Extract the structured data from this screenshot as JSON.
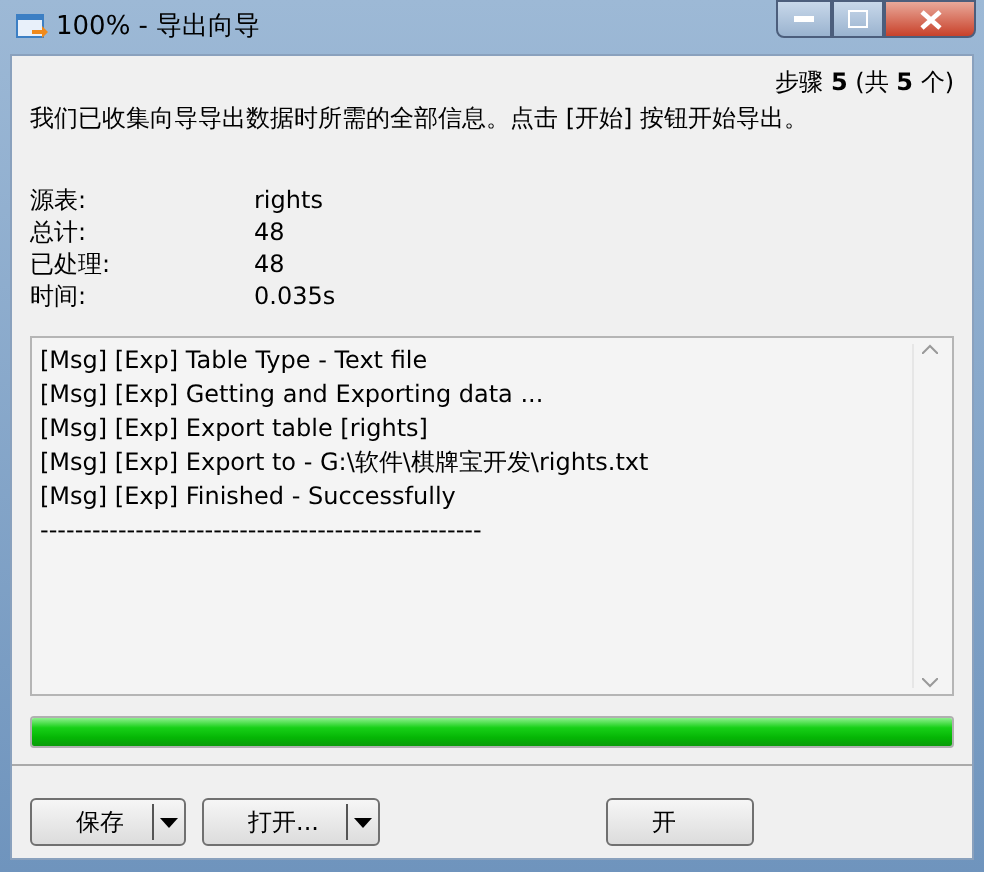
{
  "window": {
    "title": "100% - 导出向导"
  },
  "step": "步骤 **5** (共 **5** 个)",
  "description": "我们已收集向导导出数据时所需的全部信息。点击 [开始] 按钮开始导出。",
  "summary": [
    {
      "label": "源表:",
      "value": "rights"
    },
    {
      "label": "总计:",
      "value": "48"
    },
    {
      "label": "已处理:",
      "value": "48"
    },
    {
      "label": "时间:",
      "value": "0.035s"
    }
  ],
  "log": [
    "[Msg] [Exp] Table Type - Text file",
    "[Msg] [Exp] Getting and Exporting data ...",
    "[Msg] [Exp] Export table [rights]",
    "[Msg] [Exp] Export to - G:\\软件\\棋牌宝开发\\rights.txt",
    "[Msg] [Exp] Finished - Successfully",
    "---------------------------------------------------"
  ],
  "progress": {
    "level": 1
  },
  "buttons": [
    {
      "label": "保存",
      "kind": "split"
    },
    {
      "label": "打开...",
      "kind": "split"
    },
    {
      "label": "开",
      "kind": "plain"
    }
  ]
}
